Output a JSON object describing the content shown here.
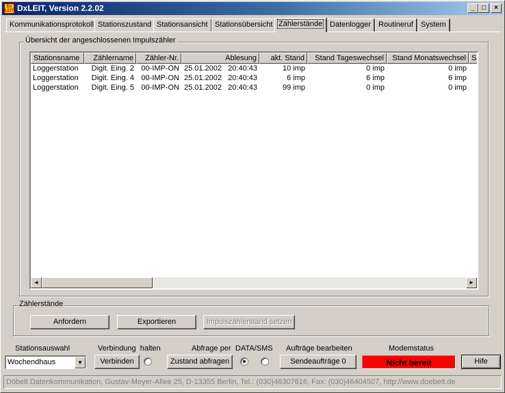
{
  "window": {
    "title": "DxLEIT, Version 2.2.02",
    "icon_text": "Dx LEIT",
    "controls": {
      "minimize": "_",
      "maximize": "□",
      "close": "×"
    }
  },
  "tabs": [
    {
      "label": "Kommunikationsprotokoll",
      "active": false
    },
    {
      "label": "Stationszustand",
      "active": false
    },
    {
      "label": "Stationsansicht",
      "active": false
    },
    {
      "label": "Stationsübersicht",
      "active": false
    },
    {
      "label": "Zählerstände",
      "active": true
    },
    {
      "label": "Datenlogger",
      "active": false
    },
    {
      "label": "Routineruf",
      "active": false
    },
    {
      "label": "System",
      "active": false
    }
  ],
  "overview": {
    "legend": "Übersicht der angeschlossenen Impulszähler",
    "columns": [
      "Stationsname",
      "Zählername",
      "Zähler-Nr.",
      "Ablesung",
      "akt. Stand",
      "Stand Tageswechsel",
      "Stand Monatswechsel",
      "S"
    ],
    "rows": [
      [
        "Loggerstation",
        "Digit. Eing. 2",
        "00-IMP-ON",
        "25.01.2002   20:40:43",
        "10 imp",
        "0 imp",
        "0 imp"
      ],
      [
        "Loggerstation",
        "Digit. Eing. 4",
        "00-IMP-ON",
        "25.01.2002   20:40:43",
        "6 imp",
        "6 imp",
        "6 imp"
      ],
      [
        "Loggerstation",
        "Digit. Eing. 5",
        "00-IMP-ON",
        "25.01.2002   20:40:43",
        "99 imp",
        "0 imp",
        "0 imp"
      ]
    ],
    "scroll_left": "◄",
    "scroll_right": "►"
  },
  "zaehlerstaende": {
    "legend": "Zählerstände",
    "request_label": "Anfordern",
    "export_label": "Exportieren",
    "set_label": "Impulszählerstand setzen"
  },
  "bottom": {
    "station_select_label": "Stationsauswahl",
    "station_value": "Wochendhaus",
    "combo_arrow": "▼",
    "connection_label": "Verbindung  halten",
    "connect_button": "Verbinden",
    "query_label": "Abfrage per",
    "data_sms_label": "DATA/SMS",
    "query_button": "Zustand abfragen",
    "jobs_label": "Aufträge bearbeiten",
    "jobs_button": "Sendeaufträge 0",
    "modem_label": "Modemstatus",
    "modem_status": "Nicht bereit",
    "modem_color": "#ff0000",
    "help_button": "Hife"
  },
  "statusbar": {
    "text": "Döbelt Datenkommunikation, Gustav-Meyer-Allee 25, D-13355 Berlin, Tel.: (030)46307616, Fax: (030)46404507, http://www.doebelt.de"
  }
}
